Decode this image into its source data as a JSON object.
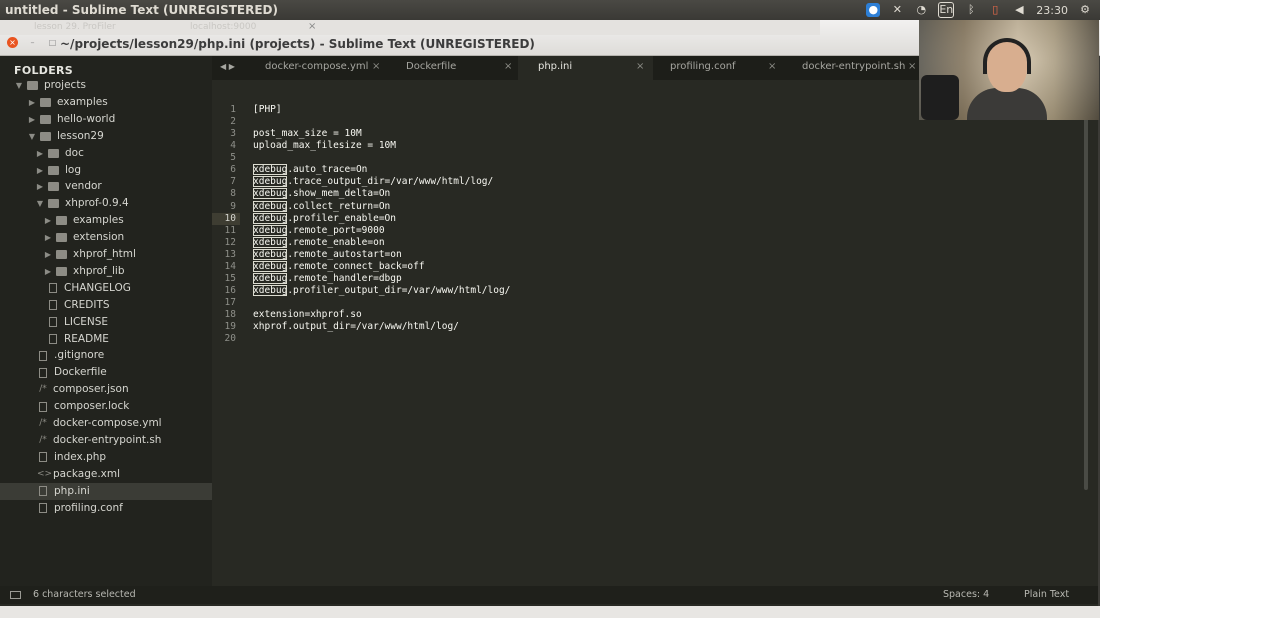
{
  "top_panel": {
    "title": "untitled - Sublime Text (UNREGISTERED)",
    "tray": {
      "lang": "En",
      "clock": "23:30"
    }
  },
  "window": {
    "title": "~/projects/lesson29/php.ini (projects) - Sublime Text (UNREGISTERED)",
    "ghost_tabs": [
      "lesson 29. ProFiler",
      "localhost:9000"
    ]
  },
  "sidebar": {
    "header": "FOLDERS",
    "items": [
      {
        "label": "projects",
        "kind": "folder",
        "expanded": true
      },
      {
        "label": "examples",
        "kind": "folder",
        "expanded": false
      },
      {
        "label": "hello-world",
        "kind": "folder",
        "expanded": false
      },
      {
        "label": "lesson29",
        "kind": "folder",
        "expanded": true
      },
      {
        "label": "doc",
        "kind": "folder",
        "expanded": false
      },
      {
        "label": "log",
        "kind": "folder",
        "expanded": false
      },
      {
        "label": "vendor",
        "kind": "folder",
        "expanded": false
      },
      {
        "label": "xhprof-0.9.4",
        "kind": "folder",
        "expanded": true
      },
      {
        "label": "examples",
        "kind": "folder",
        "expanded": false
      },
      {
        "label": "extension",
        "kind": "folder",
        "expanded": false
      },
      {
        "label": "xhprof_html",
        "kind": "folder",
        "expanded": false
      },
      {
        "label": "xhprof_lib",
        "kind": "folder",
        "expanded": false
      },
      {
        "label": "CHANGELOG",
        "kind": "file"
      },
      {
        "label": "CREDITS",
        "kind": "file"
      },
      {
        "label": "LICENSE",
        "kind": "file"
      },
      {
        "label": "README",
        "kind": "file"
      },
      {
        "label": ".gitignore",
        "kind": "file"
      },
      {
        "label": "Dockerfile",
        "kind": "file"
      },
      {
        "label": "composer.json",
        "kind": "code"
      },
      {
        "label": "composer.lock",
        "kind": "file"
      },
      {
        "label": "docker-compose.yml",
        "kind": "code"
      },
      {
        "label": "docker-entrypoint.sh",
        "kind": "code"
      },
      {
        "label": "index.php",
        "kind": "file"
      },
      {
        "label": "package.xml",
        "kind": "xml"
      },
      {
        "label": "php.ini",
        "kind": "file",
        "selected": true
      },
      {
        "label": "profiling.conf",
        "kind": "file"
      }
    ]
  },
  "tabs": [
    {
      "label": "docker-compose.yml",
      "close": "×"
    },
    {
      "label": "Dockerfile",
      "close": "×"
    },
    {
      "label": "php.ini",
      "close": "×",
      "active": true
    },
    {
      "label": "profiling.conf",
      "close": "×"
    },
    {
      "label": "docker-entrypoint.sh",
      "close": "×"
    }
  ],
  "editor": {
    "lines": [
      {
        "n": "1",
        "text": "[PHP]"
      },
      {
        "n": "2",
        "text": ""
      },
      {
        "n": "3",
        "text": "post_max_size = 10M"
      },
      {
        "n": "4",
        "text": "upload_max_filesize = 10M"
      },
      {
        "n": "5",
        "text": ""
      },
      {
        "n": "6",
        "prefix": "xdebug",
        "text": ".auto_trace=On"
      },
      {
        "n": "7",
        "prefix": "xdebug",
        "text": ".trace_output_dir=/var/www/html/log/"
      },
      {
        "n": "8",
        "prefix": "xdebug",
        "text": ".show_mem_delta=On"
      },
      {
        "n": "9",
        "prefix": "xdebug",
        "text": ".collect_return=On"
      },
      {
        "n": "10",
        "prefix": "xdebug",
        "text": ".profiler_enable=On"
      },
      {
        "n": "11",
        "prefix": "xdebug",
        "text": ".remote_port=9000"
      },
      {
        "n": "12",
        "prefix": "xdebug",
        "text": ".remote_enable=on"
      },
      {
        "n": "13",
        "prefix": "xdebug",
        "text": ".remote_autostart=on"
      },
      {
        "n": "14",
        "prefix": "xdebug",
        "text": ".remote_connect_back=off"
      },
      {
        "n": "15",
        "prefix": "xdebug",
        "text": ".remote_handler=dbgp"
      },
      {
        "n": "16",
        "prefix": "xdebug",
        "text": ".profiler_output_dir=/var/www/html/log/"
      },
      {
        "n": "17",
        "text": ""
      },
      {
        "n": "18",
        "text": "extension=xhprof.so"
      },
      {
        "n": "19",
        "text": "xhprof.output_dir=/var/www/html/log/"
      },
      {
        "n": "20",
        "text": ""
      }
    ]
  },
  "statusbar": {
    "selection": "6 characters selected",
    "indent": "Spaces: 4",
    "syntax": "Plain Text"
  },
  "colors": {
    "editor_bg": "#282923",
    "sidebar_bg": "#22231e",
    "ubuntu_orange": "#e95420"
  }
}
